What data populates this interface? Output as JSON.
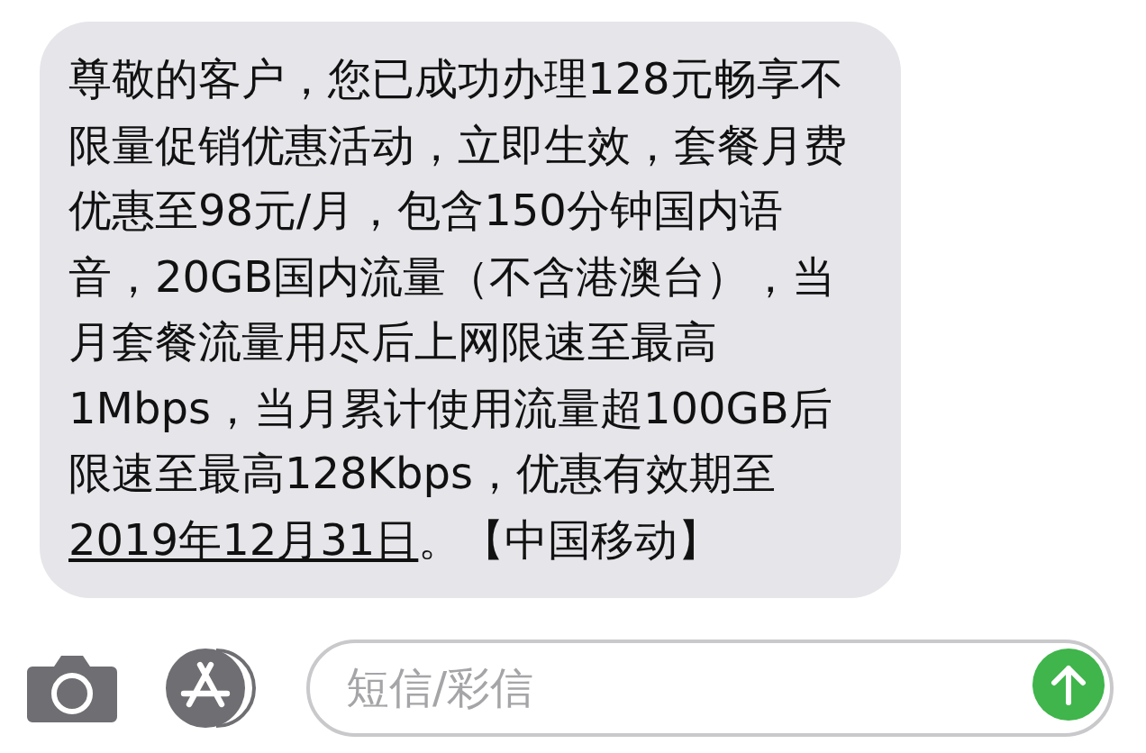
{
  "message": {
    "parts": [
      {
        "kind": "text",
        "text": "尊敬的客户，您已成功办理128元畅享不限量促销优惠活动，立即生效，套餐月费优惠至98元/月，包含150分钟国内语音，20GB国内流量（不含港澳台），当月套餐流量用尽后上网限速至最高1Mbps，当月累计使用流量超100GB后限速至最高128Kbps，优惠有效期至"
      },
      {
        "kind": "link",
        "text": "2019年12月31日"
      },
      {
        "kind": "text",
        "text": "。【中国移动】"
      }
    ]
  },
  "composer": {
    "placeholder": "短信/彩信",
    "send_enabled": true
  }
}
